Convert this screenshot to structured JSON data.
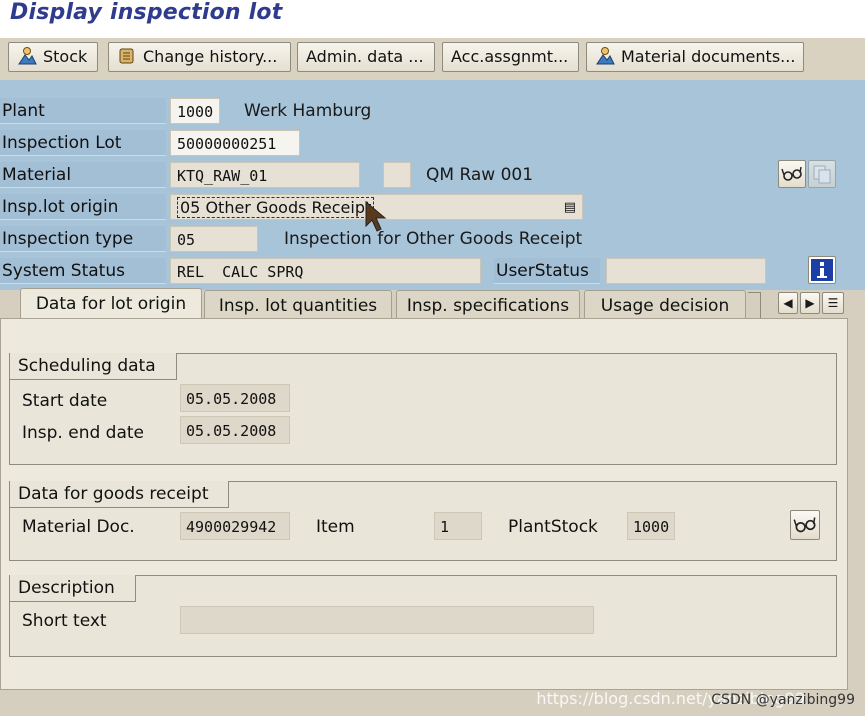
{
  "title": "Display inspection lot",
  "toolbar": {
    "stock": "Stock",
    "change_history": "Change history...",
    "admin_data": "Admin. data ...",
    "acc_assignment": "Acc.assgnmt...",
    "material_documents": "Material documents..."
  },
  "header": {
    "plant_label": "Plant",
    "plant_value": "1000",
    "plant_name": "Werk Hamburg",
    "lot_label": "Inspection Lot",
    "lot_value": "50000000251",
    "material_label": "Material",
    "material_value": "KTQ_RAW_01",
    "material_desc": "QM Raw 001",
    "origin_label": "Insp.lot origin",
    "origin_value": "05 Other Goods Receipt",
    "type_label": "Inspection type",
    "type_value": "05",
    "type_desc": "Inspection for Other Goods Receipt",
    "status_label": "System Status",
    "status_value": "REL  CALC SPRQ",
    "user_status_label": "UserStatus",
    "user_status_value": ""
  },
  "tabs": [
    {
      "label": "Data for lot origin",
      "active": true
    },
    {
      "label": "Insp. lot quantities",
      "active": false
    },
    {
      "label": "Insp. specifications",
      "active": false
    },
    {
      "label": "Usage decision",
      "active": false
    }
  ],
  "scheduling": {
    "title": "Scheduling data",
    "start_label": "Start date",
    "start_value": "05.05.2008",
    "end_label": "Insp. end date",
    "end_value": "05.05.2008"
  },
  "goods_receipt": {
    "title": "Data for goods receipt",
    "doc_label": "Material Doc.",
    "doc_value": "4900029942",
    "item_label": "Item",
    "item_value": "1",
    "plant_stock_label": "PlantStock",
    "plant_stock_value": "1000"
  },
  "description": {
    "title": "Description",
    "short_text_label": "Short text",
    "short_text_value": ""
  },
  "watermark": "https://blog.csdn.net/yanzibing99",
  "watermark_tag": "CSDN @yanzibing99",
  "icons": {
    "stock": "person-mountain-icon",
    "change_history": "scroll-icon",
    "material_documents": "person-mountain-icon",
    "glasses": "glasses-icon",
    "info": "info-icon"
  }
}
